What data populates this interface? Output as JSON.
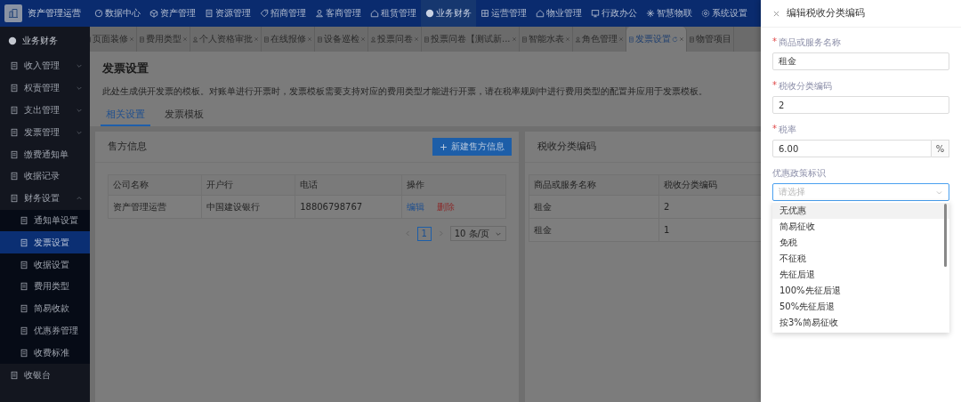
{
  "top_bar": {
    "app_name": "资产管理运营",
    "nav": [
      {
        "label": "数据中心",
        "selected": false
      },
      {
        "label": "资产管理",
        "selected": false
      },
      {
        "label": "资源管理",
        "selected": false
      },
      {
        "label": "招商管理",
        "selected": false
      },
      {
        "label": "客商管理",
        "selected": false
      },
      {
        "label": "租赁管理",
        "selected": false
      },
      {
        "label": "业务财务",
        "selected": true
      },
      {
        "label": "运营管理",
        "selected": false
      },
      {
        "label": "物业管理",
        "selected": false
      },
      {
        "label": "行政办公",
        "selected": false
      },
      {
        "label": "智慧物联",
        "selected": false
      },
      {
        "label": "系统设置",
        "selected": false
      }
    ]
  },
  "sidebar": {
    "title": "业务财务",
    "items": [
      {
        "label": "收入管理",
        "kind": "group",
        "expanded": false
      },
      {
        "label": "权责管理",
        "kind": "group",
        "expanded": false
      },
      {
        "label": "支出管理",
        "kind": "group",
        "expanded": false
      },
      {
        "label": "发票管理",
        "kind": "group",
        "expanded": false
      },
      {
        "label": "缴费通知单",
        "kind": "link",
        "selected": false
      },
      {
        "label": "收据记录",
        "kind": "link",
        "selected": false
      },
      {
        "label": "财务设置",
        "kind": "group",
        "expanded": true,
        "children": [
          {
            "label": "通知单设置",
            "selected": false
          },
          {
            "label": "发票设置",
            "selected": true
          },
          {
            "label": "收据设置",
            "selected": false
          },
          {
            "label": "费用类型",
            "selected": false
          },
          {
            "label": "简易收款",
            "selected": false
          },
          {
            "label": "优惠券管理",
            "selected": false
          },
          {
            "label": "收费标准",
            "selected": false
          }
        ]
      },
      {
        "label": "收银台",
        "kind": "link",
        "selected": false
      }
    ]
  },
  "open_tabs": [
    {
      "label": "页面装修",
      "selected": false,
      "closable": true
    },
    {
      "label": "费用类型",
      "selected": false,
      "closable": true
    },
    {
      "label": "个人资格审批",
      "selected": false,
      "closable": true
    },
    {
      "label": "在线报修",
      "selected": false,
      "closable": true
    },
    {
      "label": "设备巡检",
      "selected": false,
      "closable": true
    },
    {
      "label": "投票问卷",
      "selected": false,
      "closable": true
    },
    {
      "label": "投票问卷【测试新...",
      "selected": false,
      "closable": true
    },
    {
      "label": "智能水表",
      "selected": false,
      "closable": true
    },
    {
      "label": "角色管理",
      "selected": false,
      "closable": true
    },
    {
      "label": "发票设置",
      "selected": true,
      "closable": true
    },
    {
      "label": "物管项目",
      "selected": false,
      "closable": false
    }
  ],
  "page": {
    "title": "发票设置",
    "description": "此处生成供开发票的模板。对账单进行开票时，发票模板需要支持对应的费用类型才能进行开票，请在税率规则中进行费用类型的配置并应用于发票模板。",
    "tabs": [
      {
        "label": "相关设置",
        "selected": true
      },
      {
        "label": "发票模板",
        "selected": false
      }
    ]
  },
  "seller_card": {
    "title": "售方信息",
    "add_button": "新建售方信息",
    "table": {
      "columns": [
        "公司名称",
        "开户行",
        "电话",
        "操作"
      ],
      "rows": [
        {
          "cells": [
            "资产管理运营",
            "中国建设银行",
            "18806798767"
          ],
          "actions": [
            {
              "label": "编辑",
              "kind": "edit"
            },
            {
              "label": "删除",
              "kind": "delete"
            }
          ]
        }
      ]
    },
    "pagination": {
      "pages": [
        {
          "label": "1",
          "selected": true
        }
      ],
      "page_size": "10 条/页"
    }
  },
  "tax_card": {
    "title": "税收分类编码",
    "table": {
      "columns": [
        "商品或服务名称",
        "税收分类编码"
      ],
      "rows": [
        [
          "租金",
          "2"
        ],
        [
          "租金",
          "1"
        ]
      ]
    }
  },
  "drawer": {
    "title": "编辑税收分类编码",
    "fields": [
      {
        "label": "商品或服务名称",
        "required": true,
        "required_mark": "*",
        "kind": "text",
        "value": "租金"
      },
      {
        "label": "税收分类编码",
        "required": true,
        "required_mark": "*",
        "kind": "text",
        "value": "2"
      },
      {
        "label": "税率",
        "required": true,
        "required_mark": "*",
        "kind": "addon",
        "value": "6.00",
        "suffix": "%"
      },
      {
        "label": "优惠政策标识",
        "required": false,
        "kind": "select",
        "placeholder": "请选择",
        "focused": true
      }
    ],
    "options": [
      {
        "label": "无优惠",
        "highlighted": true
      },
      {
        "label": "简易征收",
        "highlighted": false
      },
      {
        "label": "免税",
        "highlighted": false
      },
      {
        "label": "不征税",
        "highlighted": false
      },
      {
        "label": "先征后退",
        "highlighted": false
      },
      {
        "label": "100%先征后退",
        "highlighted": false
      },
      {
        "label": "50%先征后退",
        "highlighted": false
      },
      {
        "label": "按3%简易征收",
        "highlighted": false
      }
    ]
  }
}
